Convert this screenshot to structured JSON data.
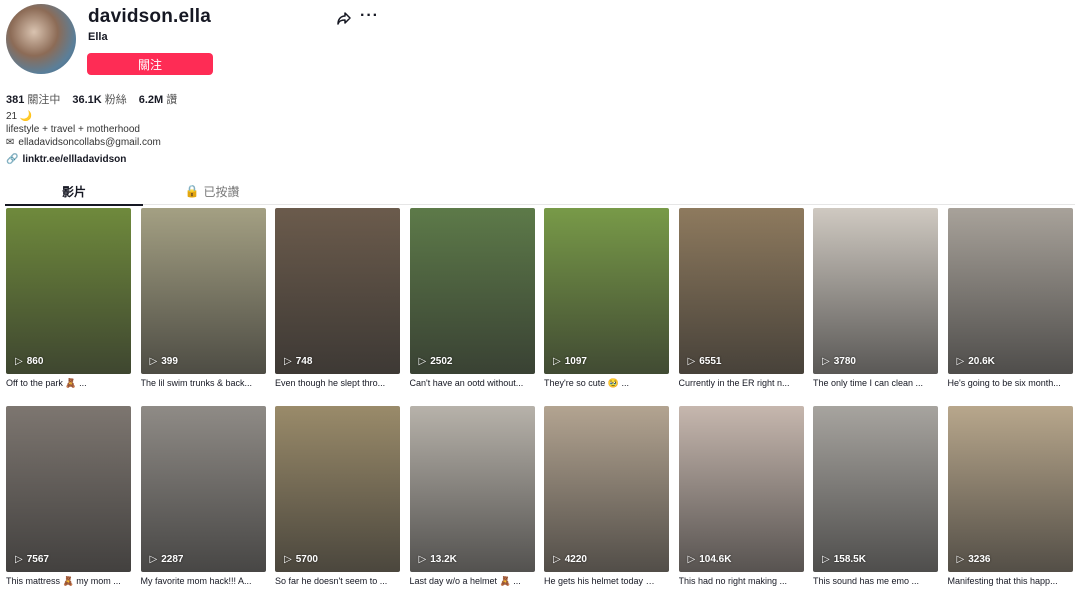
{
  "profile": {
    "username": "davidson.ella",
    "nickname": "Ella",
    "follow_label": "關注",
    "stats": {
      "following_count": "381",
      "following_label": "關注中",
      "followers_count": "36.1K",
      "followers_label": "粉絲",
      "likes_count": "6.2M",
      "likes_label": "讚"
    },
    "bio_line1": "21 🌙",
    "bio_line2": "lifestyle + travel + motherhood",
    "bio_email": "elladavidsoncollabs@gmail.com",
    "link": "linktr.ee/ellladavidson"
  },
  "tabs": [
    {
      "label": "影片"
    },
    {
      "label": "已按讚"
    }
  ],
  "videos": [
    {
      "views": "860",
      "caption": "Off to the park 🧸 ...",
      "bg": "#6f8a3c"
    },
    {
      "views": "399",
      "caption": "The lil swim trunks & back...",
      "bg": "#a4a083"
    },
    {
      "views": "748",
      "caption": "Even though he slept thro...",
      "bg": "#6b5b4c"
    },
    {
      "views": "2502",
      "caption": "Can't have an ootd without...",
      "bg": "#5d7a49"
    },
    {
      "views": "1097",
      "caption": "They're so cute 🥹 ...",
      "bg": "#789a48"
    },
    {
      "views": "6551",
      "caption": "Currently in the ER right n...",
      "bg": "#8e7a5e"
    },
    {
      "views": "3780",
      "caption": "The only time I can clean ...",
      "bg": "#cfc9c1"
    },
    {
      "views": "20.6K",
      "caption": "He's going to be six month...",
      "bg": "#a8a29a"
    },
    {
      "views": "7567",
      "caption": "This mattress 🧸 my mom ...",
      "bg": "#7d7670"
    },
    {
      "views": "2287",
      "caption": "My favorite mom hack!!! A...",
      "bg": "#8f8b86"
    },
    {
      "views": "5700",
      "caption": "So far he doesn't seem to ...",
      "bg": "#9a8b6a"
    },
    {
      "views": "13.2K",
      "caption": "Last day w/o a helmet 🧸 ...",
      "bg": "#b7b2aa"
    },
    {
      "views": "4220",
      "caption": "He gets his helmet today 🧸...",
      "bg": "#b3a491"
    },
    {
      "views": "104.6K",
      "caption": "This had no right making ...",
      "bg": "#c6b7ae"
    },
    {
      "views": "158.5K",
      "caption": "This sound has me emo ...",
      "bg": "#a7a49f"
    },
    {
      "views": "3236",
      "caption": "Manifesting that this happ...",
      "bg": "#b8a78c"
    }
  ]
}
